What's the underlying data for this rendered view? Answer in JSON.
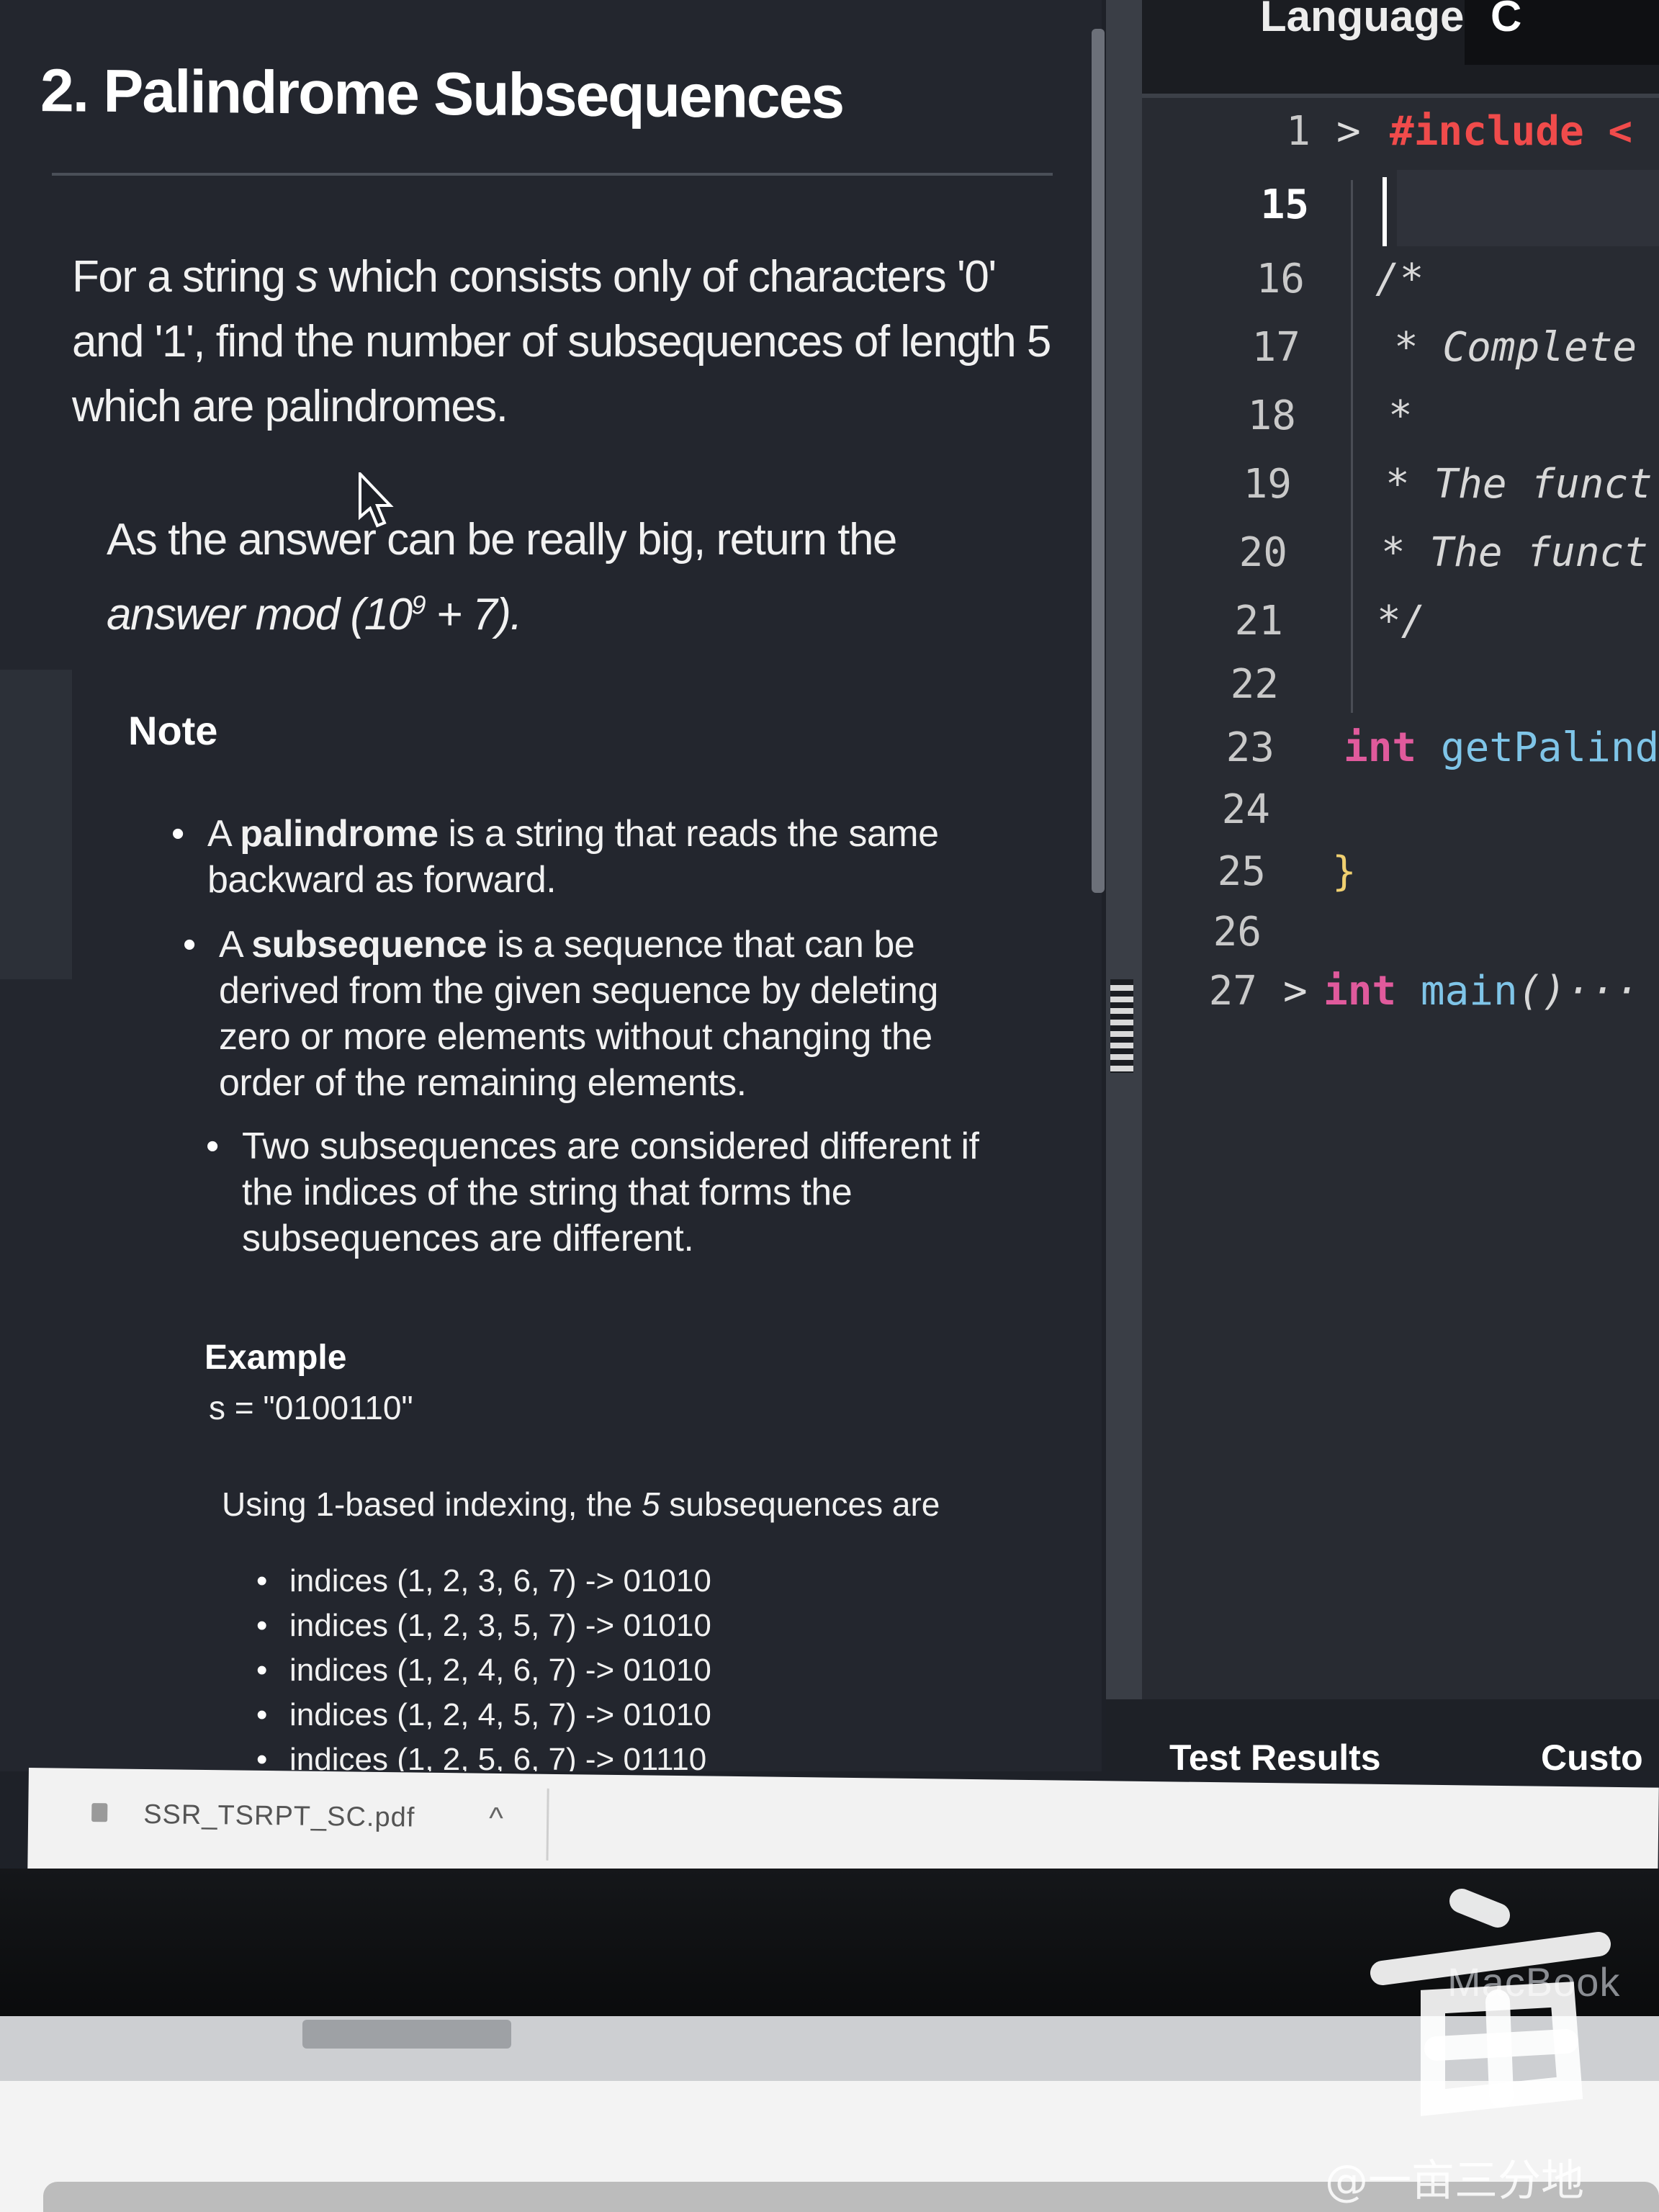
{
  "problem": {
    "title": "2. Palindrome Subsequences",
    "paragraph1": "For a string s which consists only of characters '0' and '1', find the number of subsequences of length 5 which are palindromes.",
    "paragraph2": "As the answer can be really big, return the answer mod (10⁹ + 7).",
    "note_heading": "Note",
    "notes": [
      {
        "term": "palindrome",
        "text": "A palindrome is a string that reads the same backward as forward."
      },
      {
        "term": "subsequence",
        "text": "A subsequence is a sequence that can be derived from the given sequence by deleting zero or more elements without changing the order of the remaining elements."
      },
      {
        "text": "Two subsequences are considered different if the indices of the string that forms the subsequences are different."
      }
    ],
    "example_heading": "Example",
    "example_input": "s = \"0100110\"",
    "example_intro_pre": "Using 1-based indexing, the ",
    "example_intro_count": "5",
    "example_intro_post": " subsequences are",
    "example_items": [
      "indices (1, 2, 3, 6, 7) -> 01010",
      "indices (1, 2, 3, 5, 7) -> 01010",
      "indices (1, 2, 4, 6, 7) -> 01010",
      "indices (1, 2, 4, 5, 7) -> 01010",
      "indices (1, 2, 5, 6, 7) -> 01110"
    ]
  },
  "editor": {
    "language_label": "Language",
    "language_value": "C",
    "lines": [
      {
        "n": "1",
        "fold": ">",
        "tokens": [
          {
            "cls": "kw-inc",
            "t": "#include <"
          }
        ]
      },
      {
        "n": "15",
        "active": true,
        "tokens": []
      },
      {
        "n": "16",
        "tokens": [
          {
            "cls": "comment",
            "t": "/*"
          }
        ]
      },
      {
        "n": "17",
        "tokens": [
          {
            "cls": "comment",
            "t": " * Complete"
          }
        ]
      },
      {
        "n": "18",
        "tokens": [
          {
            "cls": "comment",
            "t": " *"
          }
        ]
      },
      {
        "n": "19",
        "tokens": [
          {
            "cls": "comment",
            "t": " * The funct"
          }
        ]
      },
      {
        "n": "20",
        "tokens": [
          {
            "cls": "comment",
            "t": " * The funct"
          }
        ]
      },
      {
        "n": "21",
        "tokens": [
          {
            "cls": "comment",
            "t": " */"
          }
        ]
      },
      {
        "n": "22",
        "tokens": []
      },
      {
        "n": "23",
        "tokens": [
          {
            "cls": "kw",
            "t": "int "
          },
          {
            "cls": "fn",
            "t": "getPalind"
          }
        ]
      },
      {
        "n": "24",
        "tokens": []
      },
      {
        "n": "25",
        "tokens": [
          {
            "cls": "brace",
            "t": "}"
          }
        ]
      },
      {
        "n": "26",
        "tokens": []
      },
      {
        "n": "27",
        "fold": ">",
        "tokens": [
          {
            "cls": "kw",
            "t": "int "
          },
          {
            "cls": "fn",
            "t": "main"
          },
          {
            "cls": "comment",
            "t": "()"
          },
          {
            "cls": "comment",
            "t": "···"
          }
        ]
      }
    ],
    "tabs": [
      "Test Results",
      "Custo"
    ]
  },
  "download_bar": {
    "file_name": "SSR_TSRPT_SC.pdf",
    "chevron": "^"
  },
  "laptop": {
    "brand": "MacBook"
  },
  "watermark": {
    "text": "@一亩三分地"
  }
}
